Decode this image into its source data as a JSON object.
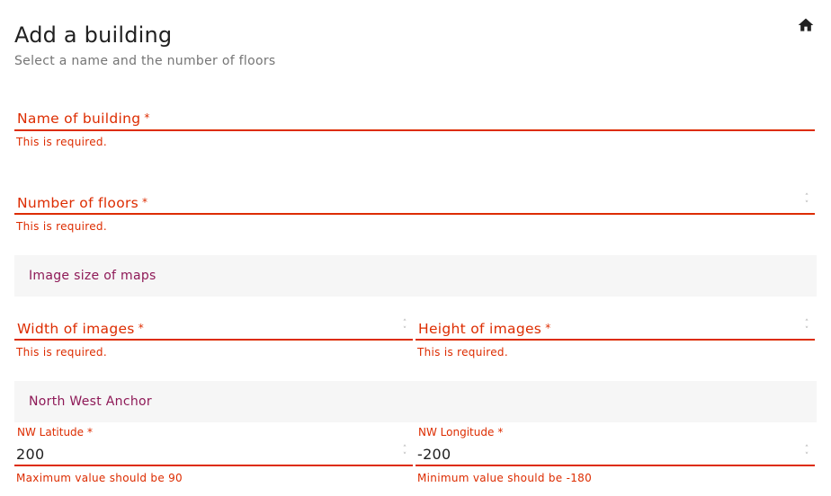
{
  "header": {
    "title": "Add a building",
    "subtitle": "Select a name and the number of floors",
    "home_icon": "home-icon"
  },
  "form": {
    "name_field": {
      "label": "Name of building",
      "required_mark": "*",
      "value": "",
      "error": "This is required."
    },
    "floors_field": {
      "label": "Number of floors",
      "required_mark": "*",
      "value": "",
      "error": "This is required."
    },
    "image_size_section": {
      "title": "Image size of maps",
      "width_field": {
        "label": "Width of images",
        "required_mark": "*",
        "value": "",
        "error": "This is required."
      },
      "height_field": {
        "label": "Height of images",
        "required_mark": "*",
        "value": "",
        "error": "This is required."
      }
    },
    "nw_anchor_section": {
      "title": "North West Anchor",
      "lat_field": {
        "label": "NW Latitude",
        "required_mark": "*",
        "value": "200",
        "error": "Maximum value should be 90"
      },
      "lng_field": {
        "label": "NW Longitude",
        "required_mark": "*",
        "value": "-200",
        "error": "Minimum value should be -180"
      }
    }
  },
  "colors": {
    "error": "#dd2c00",
    "section_title": "#8e1957",
    "section_bg": "#f6f6f6",
    "title": "#212121",
    "subtitle": "#757575"
  }
}
